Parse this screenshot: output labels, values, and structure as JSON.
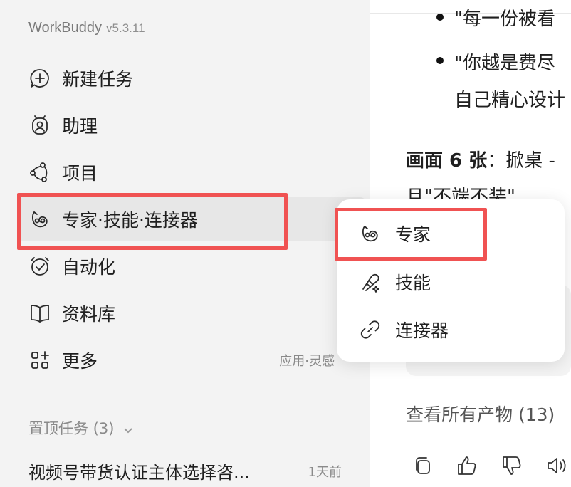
{
  "app": {
    "name": "WorkBuddy",
    "version": "v5.3.11"
  },
  "nav": [
    {
      "label": "新建任务",
      "icon": "new-task-icon"
    },
    {
      "label": "助理",
      "icon": "assistant-icon"
    },
    {
      "label": "项目",
      "icon": "project-icon"
    },
    {
      "label": "专家·技能·连接器",
      "icon": "expert-icon",
      "active": true
    },
    {
      "label": "自动化",
      "icon": "alarm-clock-icon"
    },
    {
      "label": "资料库",
      "icon": "book-icon"
    },
    {
      "label": "更多",
      "icon": "apps-grid-icon",
      "sub": "应用·灵感"
    }
  ],
  "pinned": {
    "title": "置顶任务 (3)",
    "tasks": [
      {
        "title": "视频号带货认证主体选择咨...",
        "date": "1天前"
      }
    ]
  },
  "popup": {
    "items": [
      {
        "label": "专家",
        "icon": "expert-icon"
      },
      {
        "label": "技能",
        "icon": "skill-icon"
      },
      {
        "label": "连接器",
        "icon": "link-icon"
      }
    ]
  },
  "main": {
    "line1": "\"每一份被看",
    "line2": "\"你越是费尽",
    "line3": "自己精心设计",
    "para_bold": "画面 6 张",
    "para_rest": "：掀桌 -",
    "para_line2": "且\"不端不装\"",
    "artifacts": "查看所有产物 (13)"
  },
  "actions": [
    "copy-icon",
    "thumbs-up-icon",
    "thumbs-down-icon",
    "speaker-icon"
  ],
  "colors": {
    "highlight": "#f05252",
    "sidebar_bg": "#f3f3f3",
    "active_bg": "#e7e7e7"
  }
}
